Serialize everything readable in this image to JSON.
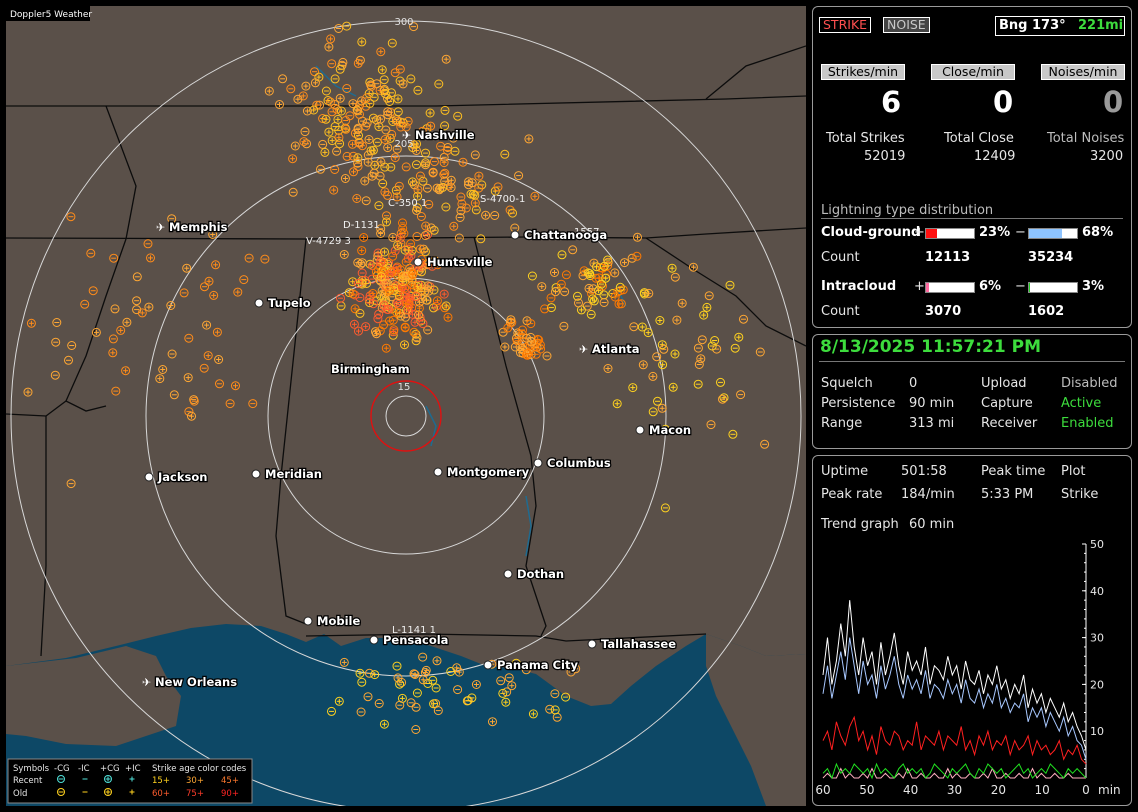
{
  "map": {
    "watermark": "Doppler5 Weather",
    "range_labels": [
      "300",
      "205",
      "15"
    ],
    "cities": [
      {
        "name": "Nashville",
        "airport": true
      },
      {
        "name": "Memphis",
        "airport": true
      },
      {
        "name": "Chattanooga",
        "airport": false
      },
      {
        "name": "Huntsville",
        "airport": false
      },
      {
        "name": "Tupelo",
        "airport": false
      },
      {
        "name": "Atlanta",
        "airport": true
      },
      {
        "name": "Birmingham",
        "airport": false
      },
      {
        "name": "Macon",
        "airport": false
      },
      {
        "name": "Jackson",
        "airport": false
      },
      {
        "name": "Meridian",
        "airport": false
      },
      {
        "name": "Montgomery",
        "airport": false
      },
      {
        "name": "Columbus",
        "airport": false
      },
      {
        "name": "Dothan",
        "airport": false
      },
      {
        "name": "Mobile",
        "airport": false
      },
      {
        "name": "Pensacola",
        "airport": false
      },
      {
        "name": "Tallahassee",
        "airport": false
      },
      {
        "name": "Panama City",
        "airport": false
      },
      {
        "name": "New Orleans",
        "airport": true
      }
    ],
    "cell_labels": [
      "C-350 1",
      "S-4700-1",
      "D-1131",
      "V-4729 3",
      "L-1141 1",
      "1557"
    ],
    "legend": {
      "symbols_label": "Symbols",
      "headers": [
        "-CG",
        "-IC",
        "+CG",
        "+IC"
      ],
      "age_label": "Strike age color codes",
      "recent_label": "Recent",
      "old_label": "Old",
      "recent_codes": [
        "15+",
        "30+",
        "45+"
      ],
      "old_codes": [
        "60+",
        "75+",
        "90+"
      ],
      "recent_colors": [
        "#ffd21f",
        "#ffa733",
        "#ff7a2e"
      ],
      "old_colors": [
        "#ff5c2e",
        "#ff3d2b",
        "#ff2424"
      ]
    }
  },
  "top": {
    "strike_btn": "STRIKE",
    "noise_btn": "NOISE",
    "bearing": "Bng 173°",
    "distance": "221mi",
    "strikes_btn": "Strikes/min",
    "close_btn": "Close/min",
    "noises_btn": "Noises/min",
    "strikes_val": "6",
    "close_val": "0",
    "noises_val": "0",
    "total_strikes_label": "Total Strikes",
    "total_close_label": "Total Close",
    "total_noises_label": "Total Noises",
    "total_strikes": "52019",
    "total_close": "12409",
    "total_noises": "3200",
    "dist_title": "Lightning type distribution",
    "cg_label": "Cloud-ground",
    "ic_label": "Intracloud",
    "count_label": "Count",
    "cg_pos_pct": "23%",
    "cg_neg_pct": "68%",
    "cg_pos_count": "12113",
    "cg_neg_count": "35234",
    "ic_pos_pct": "6%",
    "ic_neg_pct": "3%",
    "ic_pos_count": "3070",
    "ic_neg_count": "1602",
    "plus": "+",
    "minus": "−",
    "cg_pos_fill": 0.23,
    "cg_neg_fill": 0.68,
    "ic_pos_fill": 0.06,
    "ic_neg_fill": 0.03
  },
  "status": {
    "datetime": "8/13/2025 11:57:21 PM",
    "squelch_label": "Squelch",
    "squelch": "0",
    "persistence_label": "Persistence",
    "persistence": "90 min",
    "range_label": "Range",
    "range": "313 mi",
    "upload_label": "Upload",
    "upload": "Disabled",
    "capture_label": "Capture",
    "capture": "Active",
    "receiver_label": "Receiver",
    "receiver": "Enabled"
  },
  "trend": {
    "uptime_label": "Uptime",
    "uptime": "501:58",
    "peak_time_label": "Peak time",
    "peak_time": "5:33 PM",
    "plot_label": "Plot",
    "plot": "Strike",
    "peak_rate_label": "Peak rate",
    "peak_rate": "184/min",
    "trend_label": "Trend graph",
    "trend_val": "60 min",
    "chart_data": {
      "type": "line",
      "x_ticks": [
        "60",
        "50",
        "40",
        "30",
        "20",
        "10",
        "0"
      ],
      "x_unit": "min",
      "y_ticks": [
        "50",
        "40",
        "30",
        "20",
        "10"
      ],
      "ylim": [
        0,
        50
      ],
      "xlim": [
        60,
        0
      ],
      "series": [
        {
          "color": "#ffffff",
          "values": [
            22,
            30,
            20,
            25,
            33,
            26,
            38,
            28,
            22,
            30,
            24,
            27,
            20,
            29,
            22,
            26,
            31,
            24,
            20,
            27,
            23,
            25,
            22,
            28,
            20,
            24,
            23,
            21,
            26,
            22,
            24,
            19,
            25,
            21,
            20,
            23,
            18,
            22,
            20,
            24,
            19,
            21,
            17,
            20,
            18,
            22,
            15,
            19,
            16,
            18,
            14,
            17,
            15,
            13,
            16,
            12,
            14,
            11,
            9,
            6
          ]
        },
        {
          "color": "#a8c8ff",
          "values": [
            18,
            24,
            17,
            22,
            27,
            21,
            30,
            24,
            18,
            25,
            20,
            22,
            17,
            24,
            19,
            22,
            26,
            20,
            17,
            22,
            19,
            21,
            18,
            23,
            17,
            20,
            19,
            17,
            21,
            18,
            20,
            16,
            21,
            17,
            16,
            19,
            15,
            18,
            16,
            20,
            15,
            17,
            14,
            16,
            15,
            18,
            12,
            15,
            13,
            15,
            11,
            14,
            12,
            10,
            13,
            9,
            11,
            8,
            7,
            4
          ]
        },
        {
          "color": "#ff2020",
          "values": [
            8,
            10,
            6,
            12,
            9,
            7,
            11,
            13,
            8,
            10,
            6,
            9,
            5,
            11,
            8,
            7,
            10,
            9,
            6,
            8,
            7,
            12,
            6,
            9,
            8,
            7,
            10,
            6,
            9,
            8,
            7,
            11,
            6,
            8,
            5,
            9,
            7,
            10,
            6,
            8,
            7,
            9,
            5,
            8,
            6,
            7,
            9,
            5,
            8,
            6,
            7,
            5,
            6,
            8,
            4,
            6,
            5,
            7,
            4,
            3
          ]
        },
        {
          "color": "#20e020",
          "values": [
            1,
            2,
            0,
            3,
            1,
            2,
            1,
            3,
            2,
            1,
            2,
            0,
            3,
            1,
            2,
            1,
            0,
            2,
            3,
            1,
            2,
            1,
            2,
            0,
            1,
            3,
            2,
            1,
            0,
            2,
            1,
            2,
            3,
            1,
            0,
            2,
            1,
            3,
            2,
            1,
            2,
            0,
            1,
            2,
            3,
            1,
            2,
            0,
            1,
            2,
            1,
            3,
            2,
            1,
            0,
            2,
            1,
            2,
            1,
            0
          ]
        },
        {
          "color": "#ffb0c0",
          "values": [
            0,
            1,
            0,
            0,
            2,
            0,
            1,
            0,
            0,
            1,
            0,
            2,
            0,
            0,
            1,
            0,
            0,
            1,
            0,
            2,
            0,
            0,
            1,
            0,
            0,
            1,
            0,
            0,
            2,
            0,
            1,
            0,
            0,
            1,
            0,
            0,
            1,
            0,
            2,
            0,
            0,
            1,
            0,
            0,
            1,
            0,
            0,
            2,
            0,
            1,
            0,
            0,
            1,
            0,
            0,
            1,
            0,
            0,
            0,
            0
          ]
        }
      ]
    }
  }
}
